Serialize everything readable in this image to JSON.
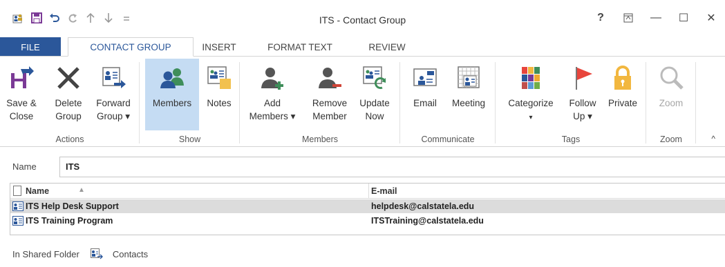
{
  "window": {
    "title": "ITS - Contact Group"
  },
  "quick_access": {
    "icons": [
      "contact-group-icon",
      "save-icon",
      "undo-icon",
      "redo-icon",
      "up-icon",
      "down-icon",
      "customize-icon"
    ]
  },
  "window_controls": {
    "help": "?",
    "ribbon_display": "↥",
    "minimize": "—",
    "restore": "☐",
    "close": "✕"
  },
  "tabs": [
    {
      "label": "FILE"
    },
    {
      "label": "CONTACT GROUP"
    },
    {
      "label": "INSERT"
    },
    {
      "label": "FORMAT TEXT"
    },
    {
      "label": "REVIEW"
    }
  ],
  "ribbon": {
    "groups": {
      "actions": {
        "label": "Actions",
        "save_close": [
          "Save &",
          "Close"
        ],
        "delete_group": [
          "Delete",
          "Group"
        ],
        "forward_group": [
          "Forward",
          "Group ▾"
        ]
      },
      "show": {
        "label": "Show",
        "members": "Members",
        "notes": "Notes"
      },
      "members": {
        "label": "Members",
        "add_members": [
          "Add",
          "Members ▾"
        ],
        "remove_member": [
          "Remove",
          "Member"
        ],
        "update_now": [
          "Update",
          "Now"
        ]
      },
      "communicate": {
        "label": "Communicate",
        "email": "Email",
        "meeting": "Meeting"
      },
      "tags": {
        "label": "Tags",
        "categorize": [
          "Categorize",
          "▾"
        ],
        "follow_up": [
          "Follow",
          "Up ▾"
        ],
        "private": "Private"
      },
      "zoom": {
        "label": "Zoom",
        "zoom": "Zoom"
      }
    },
    "collapse": "^"
  },
  "name_field": {
    "label": "Name",
    "value": "ITS"
  },
  "member_list": {
    "columns": {
      "name": "Name",
      "email": "E-mail"
    },
    "rows": [
      {
        "name": "ITS Help Desk Support",
        "email": "helpdesk@calstatela.edu",
        "selected": true
      },
      {
        "name": "ITS Training Program",
        "email": "ITSTraining@calstatela.edu",
        "selected": false
      }
    ]
  },
  "status": {
    "label": "In Shared Folder",
    "folder": "Contacts"
  },
  "colors": {
    "accent": "#2b579a",
    "selected_button": "#c5dcf3",
    "flag_red": "#e8453c",
    "lock_yellow": "#f2b73f"
  }
}
